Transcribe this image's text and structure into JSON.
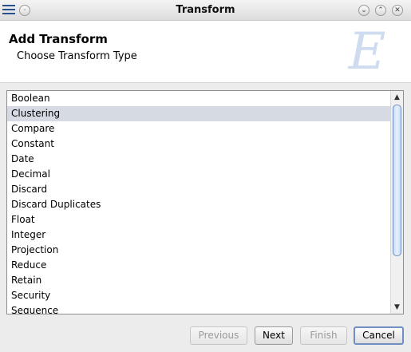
{
  "window": {
    "title": "Transform",
    "menu_icon": "hamburger-menu-icon",
    "controls": {
      "minimize": "⌄",
      "maximize": "⌃",
      "close": "✕"
    }
  },
  "header": {
    "title": "Add Transform",
    "subtitle": "Choose Transform Type",
    "logo_letter": "E"
  },
  "list": {
    "selected_index": 1,
    "items": [
      "Boolean",
      "Clustering",
      "Compare",
      "Constant",
      "Date",
      "Decimal",
      "Discard",
      "Discard Duplicates",
      "Float",
      "Integer",
      "Projection",
      "Reduce",
      "Retain",
      "Security",
      "Sequence"
    ],
    "scroll_up": "▲",
    "scroll_down": "▼"
  },
  "buttons": {
    "previous": "Previous",
    "next": "Next",
    "finish": "Finish",
    "cancel": "Cancel"
  },
  "colors": {
    "selection": "#d6dae2",
    "accent": "#6f8fc4",
    "menu_icon": "#2a4f8f"
  }
}
